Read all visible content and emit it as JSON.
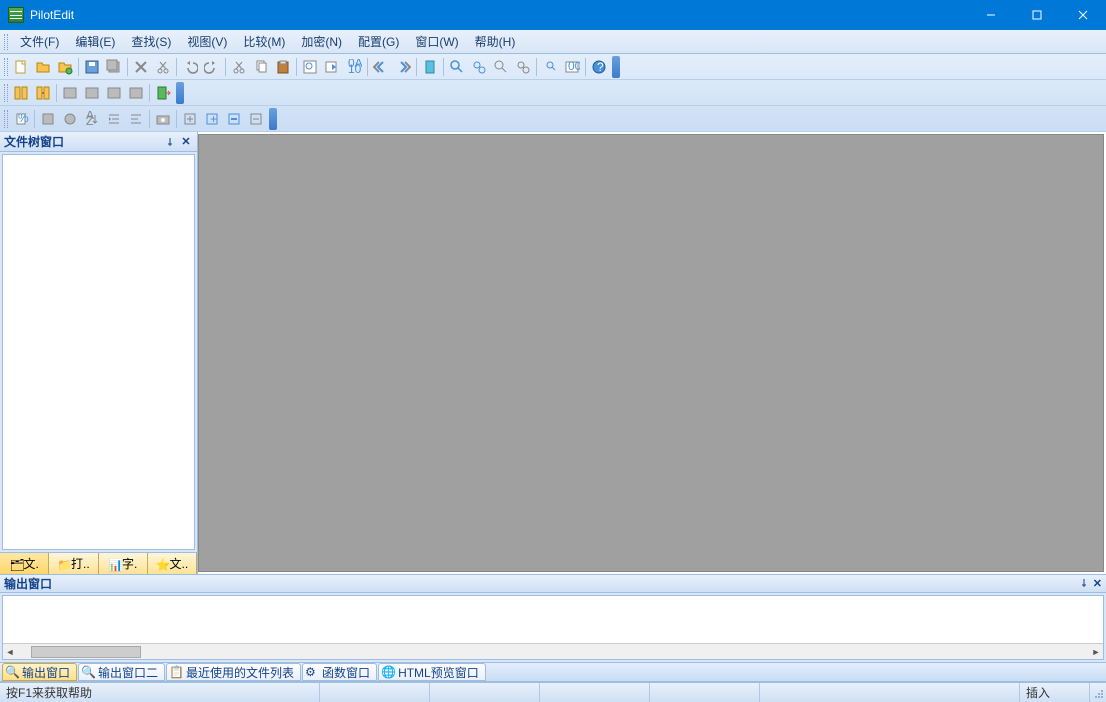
{
  "title": "PilotEdit",
  "menu": [
    "文件(F)",
    "编辑(E)",
    "查找(S)",
    "视图(V)",
    "比较(M)",
    "加密(N)",
    "配置(G)",
    "窗口(W)",
    "帮助(H)"
  ],
  "left_panel": {
    "title": "文件树窗口"
  },
  "left_tabs": [
    "文.",
    "打..",
    "字.",
    "文.."
  ],
  "output_panel": {
    "title": "输出窗口"
  },
  "bottom_tabs": [
    "输出窗口",
    "输出窗口二",
    "最近使用的文件列表",
    "函数窗口",
    "HTML预览窗口"
  ],
  "status": {
    "help": "按F1来获取帮助",
    "mode": "插入"
  }
}
